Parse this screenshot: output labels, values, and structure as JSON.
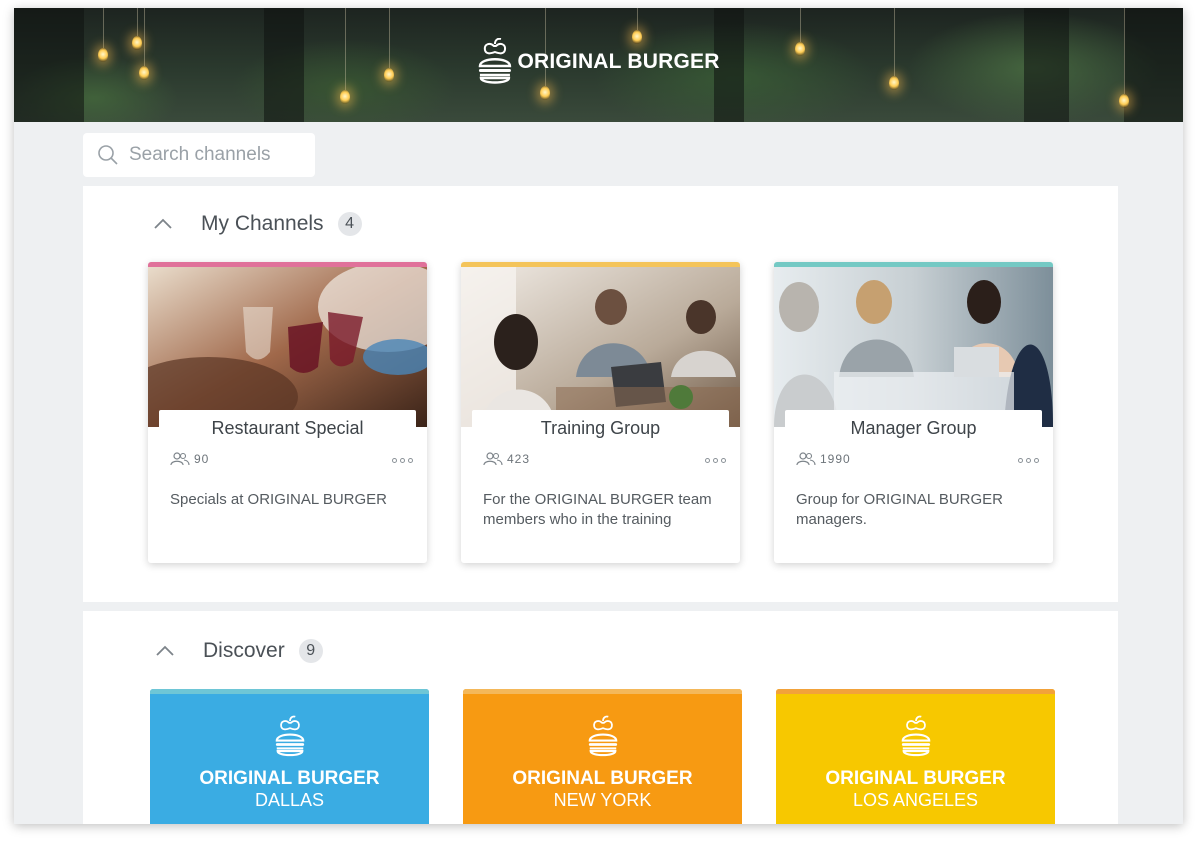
{
  "brand": {
    "name": "ORIGINAL BURGER",
    "icon": "burger-icon"
  },
  "search": {
    "placeholder": "Search channels",
    "icon": "search-icon"
  },
  "my_channels": {
    "title": "My Channels",
    "count": "4",
    "cards": [
      {
        "title": "Restaurant Special",
        "members": "90",
        "description": "Specials at ORIGINAL BURGER",
        "accent": "#e0719a"
      },
      {
        "title": "Training Group",
        "members": "423",
        "description": "For the ORIGINAL BURGER team members who in the training",
        "accent": "#f4c45a"
      },
      {
        "title": "Manager Group",
        "members": "1990",
        "description": "Group for ORIGINAL BURGER managers.",
        "accent": "#74c9c4"
      }
    ]
  },
  "discover": {
    "title": "Discover",
    "count": "9",
    "tiles": [
      {
        "name": "ORIGINAL BURGER",
        "city": "DALLAS",
        "color": "#3aace3",
        "accent": "#6ec6d6"
      },
      {
        "name": "ORIGINAL BURGER",
        "city": "NEW YORK",
        "color": "#f79a12",
        "accent": "#f4b85a"
      },
      {
        "name": "ORIGINAL BURGER",
        "city": "LOS ANGELES",
        "color": "#f7c800",
        "accent": "#f2a23a"
      }
    ]
  }
}
